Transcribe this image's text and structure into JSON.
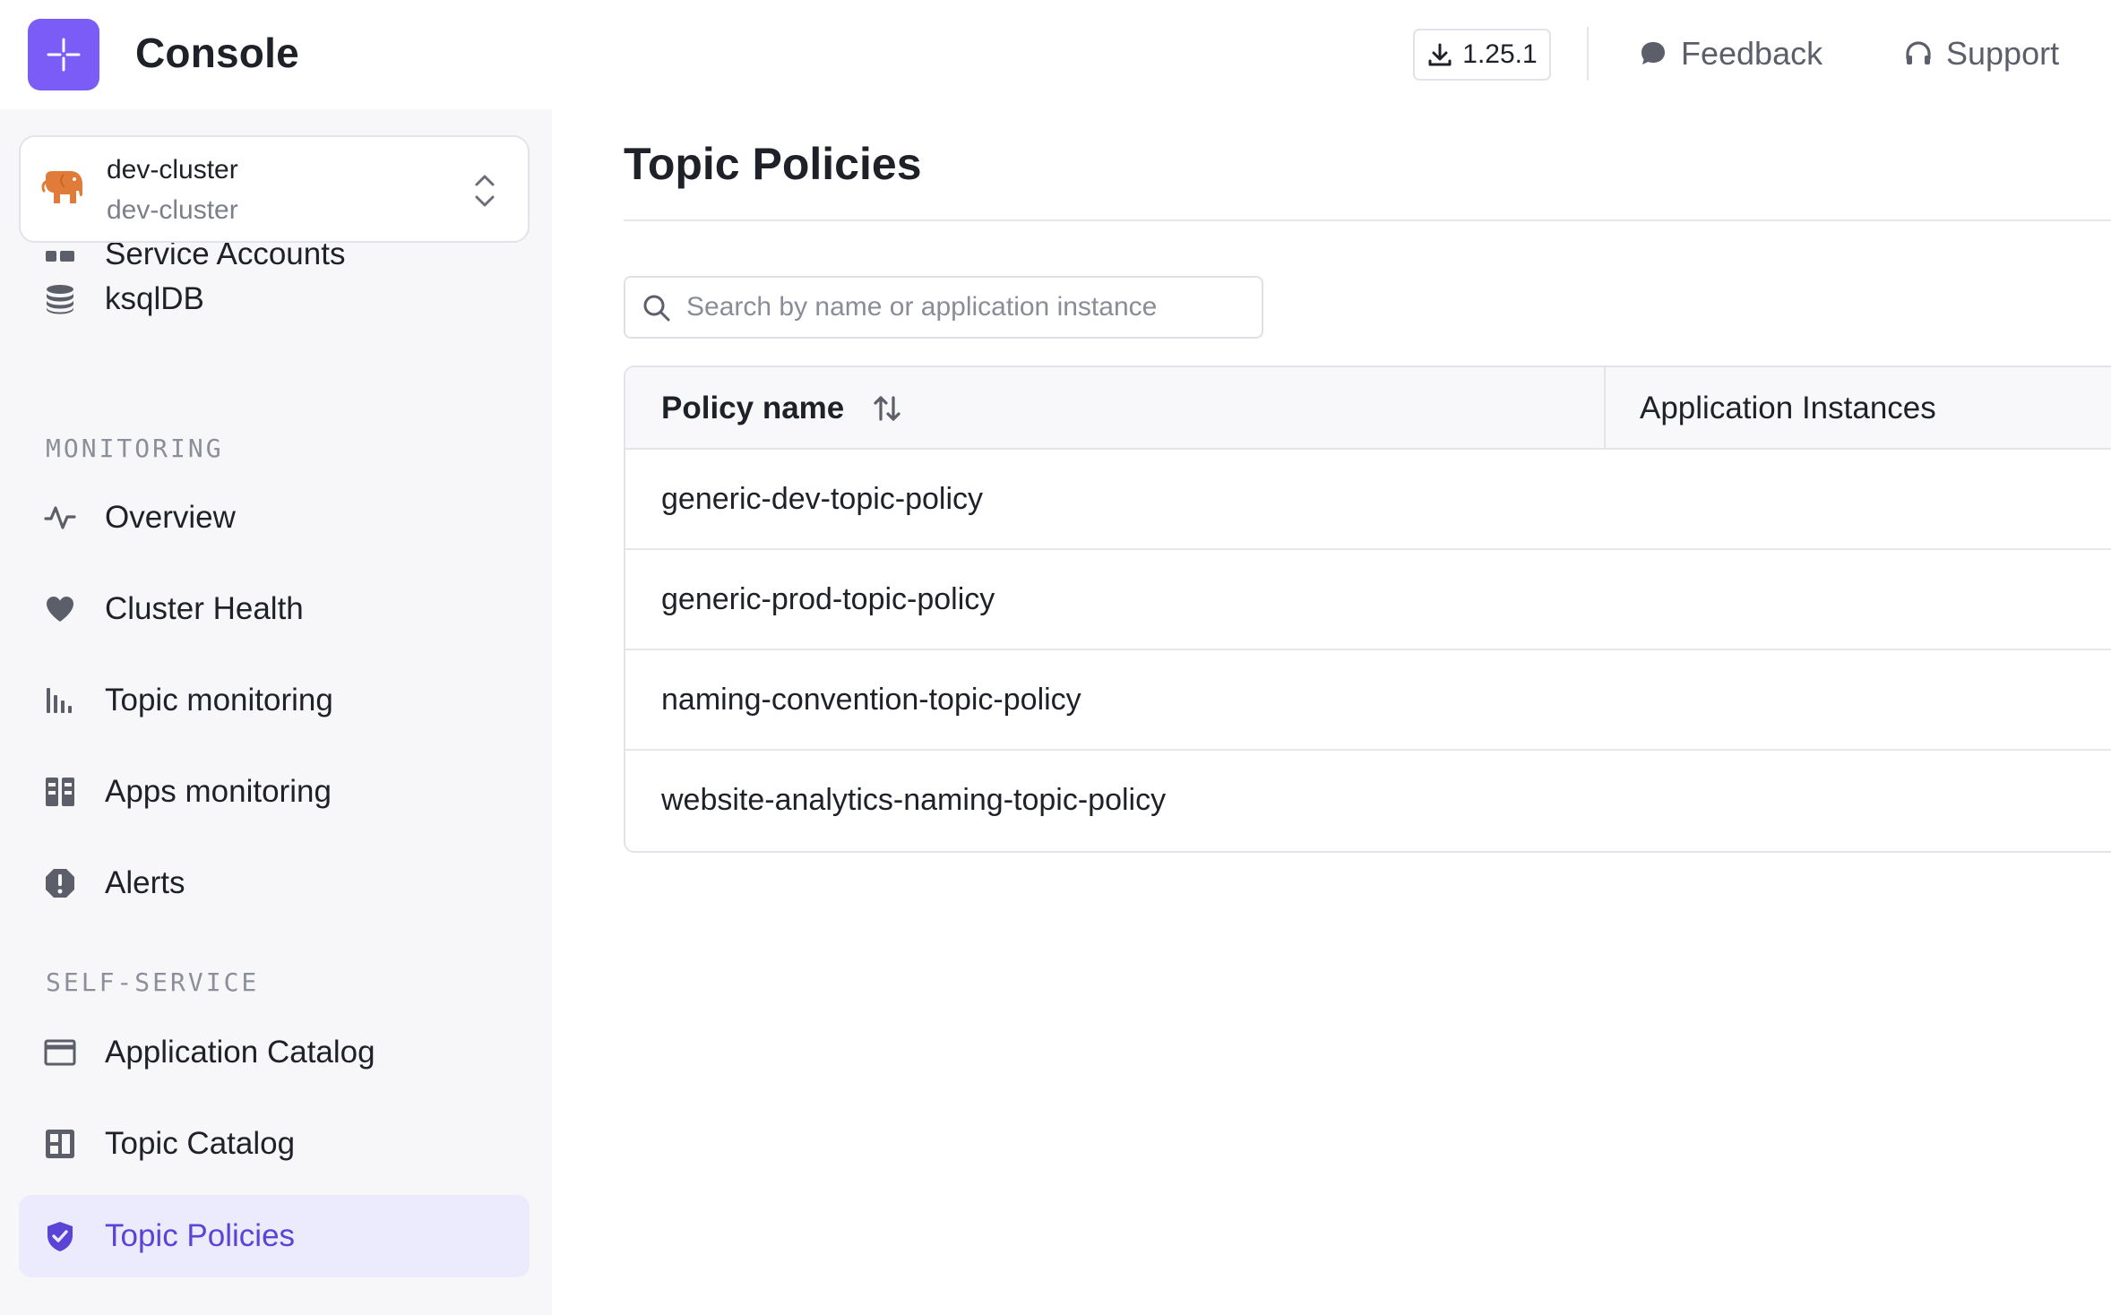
{
  "topbar": {
    "app_title": "Console",
    "version_label": "1.25.1",
    "feedback_label": "Feedback",
    "support_label": "Support"
  },
  "cluster": {
    "name": "dev-cluster",
    "subtitle": "dev-cluster"
  },
  "sidebar": {
    "partial_item_label": "Service Accounts",
    "ksqldb_label": "ksqlDB",
    "monitoring_section": "MONITORING",
    "monitoring_items": [
      {
        "label": "Overview"
      },
      {
        "label": "Cluster Health"
      },
      {
        "label": "Topic monitoring"
      },
      {
        "label": "Apps monitoring"
      },
      {
        "label": "Alerts"
      }
    ],
    "self_service_section": "SELF-SERVICE",
    "self_service_items": [
      {
        "label": "Application Catalog"
      },
      {
        "label": "Topic Catalog"
      },
      {
        "label": "Topic Policies",
        "active": true
      }
    ]
  },
  "main": {
    "page_title": "Topic Policies",
    "search": {
      "placeholder": "Search by name or application instance",
      "value": ""
    },
    "table": {
      "columns": [
        "Policy name",
        "Application Instances"
      ],
      "rows": [
        {
          "policy_name": "generic-dev-topic-policy",
          "application_instances": ""
        },
        {
          "policy_name": "generic-prod-topic-policy",
          "application_instances": ""
        },
        {
          "policy_name": "naming-convention-topic-policy",
          "application_instances": ""
        },
        {
          "policy_name": "website-analytics-naming-topic-policy",
          "application_instances": ""
        }
      ]
    }
  },
  "colors": {
    "brand": "#7b5cf6",
    "active_text": "#5a43d6",
    "active_bg": "#ecebfd",
    "cluster_icon": "#e07b39"
  },
  "icons": {
    "logo": "console-logo-icon",
    "download": "download-icon",
    "feedback": "chat-bubble-icon",
    "support": "headphones-icon",
    "cluster": "elephant-icon",
    "cluster_switch": "chevron-up-down-icon",
    "ksqldb": "database-icon",
    "overview": "activity-icon",
    "cluster_health": "heart-icon",
    "topic_monitoring": "bar-chart-icon",
    "apps_monitoring": "columns-icon",
    "alerts": "alert-octagon-icon",
    "application_catalog": "window-icon",
    "topic_catalog": "layout-icon",
    "topic_policies": "shield-check-icon",
    "search": "search-icon",
    "sort": "sort-icon"
  }
}
